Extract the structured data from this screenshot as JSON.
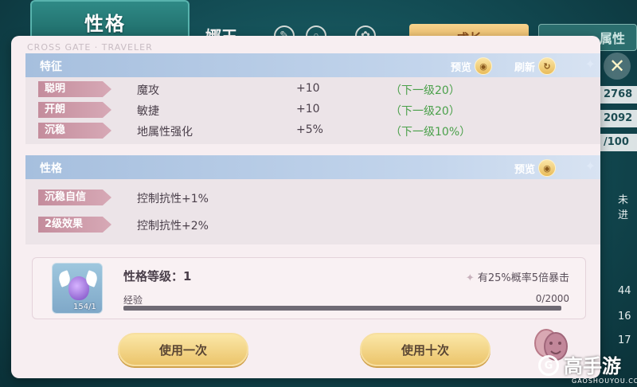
{
  "background": {
    "title": "性格",
    "character_name": "娜王",
    "grow_button": "成长",
    "attr_button": "属性",
    "stats": [
      "2768",
      "2092",
      "/100"
    ],
    "side_text": [
      "未进",
      "44",
      "16",
      "17"
    ]
  },
  "panel": {
    "subtitle": "CROSS GATE · TRAVELER",
    "traits": {
      "title": "特征",
      "preview_label": "预览",
      "refresh_label": "刷新",
      "rows": [
        {
          "tag": "聪明",
          "attribute": "魔攻",
          "value": "+10",
          "next": "（下一级20）"
        },
        {
          "tag": "开朗",
          "attribute": "敏捷",
          "value": "+10",
          "next": "（下一级20）"
        },
        {
          "tag": "沉稳",
          "attribute": "地属性强化",
          "value": "+5%",
          "next": "（下一级10%）"
        }
      ]
    },
    "personality": {
      "title": "性格",
      "preview_label": "预览",
      "rows": [
        {
          "tag": "沉稳自信",
          "effect": "控制抗性+1%"
        },
        {
          "tag": "2级效果",
          "effect": "控制抗性+2%"
        }
      ]
    },
    "level_card": {
      "item_count": "154/1",
      "level_label": "性格等级：1",
      "crit_text": "有25%概率5倍暴击",
      "exp_label": "经验",
      "exp_value": "0/2000",
      "exp_fraction": 0
    },
    "buttons": {
      "use_once": "使用一次",
      "use_ten": "使用十次"
    }
  },
  "watermark": {
    "text": "高手游",
    "sub": "GAOSHOUYOU.COM",
    "icon": "G"
  },
  "colors": {
    "header_blue": "#a6bfde",
    "tag_pink": "#c48c9c",
    "next_green": "#4aa04a",
    "gold_button": "#ebc46b"
  }
}
